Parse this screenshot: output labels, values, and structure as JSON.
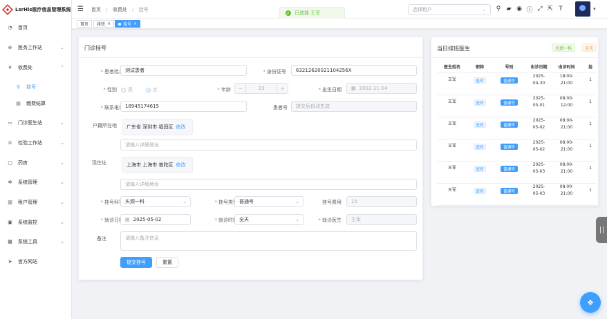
{
  "app": {
    "title": "LsrHis医疗信息管理系统"
  },
  "sidebar": {
    "items": [
      {
        "label": "首页",
        "icon": "dashboard-icon"
      },
      {
        "label": "医务工作站",
        "icon": "medical-icon",
        "expand": "⌄"
      },
      {
        "label": "收费处",
        "icon": "yuan-icon",
        "expand": "⌃"
      },
      {
        "label": "挂号",
        "icon": "search-icon"
      },
      {
        "label": "缴费结算",
        "icon": "document-icon"
      },
      {
        "label": "门诊医生站",
        "icon": "doctor-icon",
        "expand": "⌄"
      },
      {
        "label": "检验工作站",
        "icon": "lab-icon",
        "expand": "⌄"
      },
      {
        "label": "药房",
        "icon": "pharmacy-icon",
        "expand": "⌄"
      },
      {
        "label": "系统管理",
        "icon": "gear-icon",
        "expand": "⌄"
      },
      {
        "label": "租户管理",
        "icon": "tenant-icon",
        "expand": "⌄"
      },
      {
        "label": "系统监控",
        "icon": "monitor-icon",
        "expand": "⌄"
      },
      {
        "label": "系统工具",
        "icon": "tools-icon",
        "expand": "⌄"
      },
      {
        "label": "官方网站",
        "icon": "send-icon"
      }
    ]
  },
  "header": {
    "breadcrumb": [
      "首页",
      "/",
      "收费处",
      "/",
      "挂号"
    ],
    "toast": "已选择 王军",
    "tenant_placeholder": "选择租户",
    "icons": [
      "search-icon",
      "chat-icon",
      "github-icon",
      "help-icon",
      "fullscreen-icon",
      "size-icon",
      "font-icon"
    ]
  },
  "tags": [
    {
      "label": "首页"
    },
    {
      "label": "排班",
      "close": "×"
    },
    {
      "label": "挂号",
      "close": "×"
    }
  ],
  "form": {
    "title": "门诊挂号",
    "labels": {
      "patient_name": "患者姓名",
      "id_card": "身份证号",
      "gender": "性别",
      "age": "年龄",
      "birth_date": "出生日期",
      "phone": "联系电话",
      "patient_no": "患者号",
      "hukou": "户籍所在地",
      "current_addr": "现住址",
      "dept": "挂号科室",
      "reg_type": "挂号类型",
      "fee": "挂号费用",
      "visit_date": "就诊日期",
      "visit_period": "就诊时段",
      "doctor": "就诊医生",
      "remark": "备注"
    },
    "values": {
      "patient_name": "测试患者",
      "id_card": "632126200211042​56X",
      "gender_male": "男",
      "gender_female": "女",
      "age": "23",
      "birth_date": "2002-11-04",
      "phone": "18945174615",
      "patient_no_placeholder": "提交后自动生成",
      "hukou": "广东省 深圳市 福田区",
      "hukou_edit": "修改",
      "hukou_detail_placeholder": "请输入详细地址",
      "current_addr": "上海市 上海市 普陀区",
      "current_edit": "修改",
      "current_detail_placeholder": "请输入详细地址",
      "dept": "头颈一科",
      "reg_type": "普通号",
      "fee": "15",
      "visit_date": "2025-05-02",
      "visit_period": "全天",
      "doctor": "王军",
      "remark_placeholder": "请输入备注信息"
    },
    "buttons": {
      "submit": "提交挂号",
      "reset": "重置"
    },
    "num_minus": "−",
    "num_plus": "+",
    "required": "*"
  },
  "schedule": {
    "title": "当日排班医生",
    "tags": [
      "头颈一科",
      "全天"
    ],
    "columns": [
      "医生姓名",
      "职称",
      "号别",
      "出诊日期",
      "出诊时间",
      "挂"
    ],
    "rows": [
      {
        "name": "王军",
        "title": "医师",
        "type": "普通号",
        "date1": "2025-",
        "date2": "04-30",
        "time1": "18:00-",
        "time2": "21:00",
        "last": "1"
      },
      {
        "name": "王军",
        "title": "医师",
        "type": "普通号",
        "date1": "2025-",
        "date2": "05-01",
        "time1": "08:00-",
        "time2": "12:00",
        "last": "1"
      },
      {
        "name": "王军",
        "title": "医师",
        "type": "普通号",
        "date1": "2025-",
        "date2": "05-02",
        "time1": "08:00-",
        "time2": "21:00",
        "last": "1"
      },
      {
        "name": "王军",
        "title": "医师",
        "type": "普通号",
        "date1": "2025-",
        "date2": "05-02",
        "time1": "08:00-",
        "time2": "21:00",
        "last": "1"
      },
      {
        "name": "王军",
        "title": "医师",
        "type": "普通号",
        "date1": "2025-",
        "date2": "05-03",
        "time1": "08:00-",
        "time2": "21:00",
        "last": "1"
      },
      {
        "name": "王军",
        "title": "医师",
        "type": "普通号",
        "date1": "2025-",
        "date2": "05-03",
        "time1": "08:00-",
        "time2": "21:00",
        "last": "1"
      }
    ]
  },
  "colors": {
    "accent": "#409eff",
    "success": "#67c23a",
    "danger": "#f56c6c",
    "brand": "#d0342c"
  }
}
